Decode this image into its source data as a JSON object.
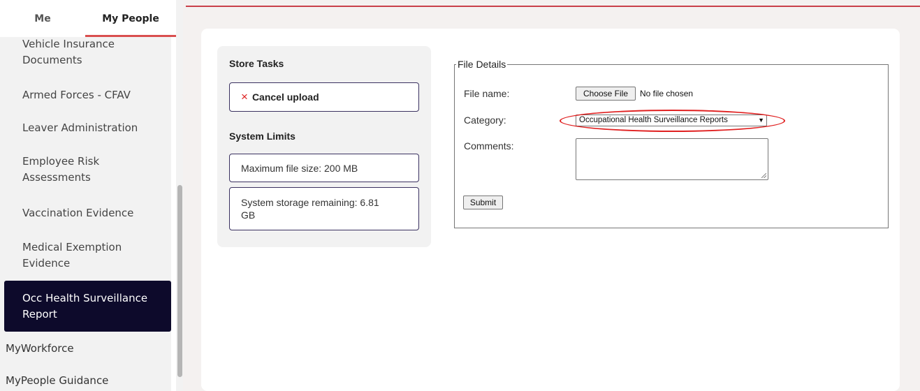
{
  "tabs": {
    "me": "Me",
    "my_people": "My People"
  },
  "sidebar": {
    "items": [
      {
        "line1": "Vehicle Insurance",
        "line2": "Documents"
      },
      {
        "line1": "Armed Forces - CFAV",
        "line2": ""
      },
      {
        "line1": "Leaver Administration",
        "line2": ""
      },
      {
        "line1": "Employee Risk",
        "line2": "Assessments"
      },
      {
        "line1": "Vaccination Evidence",
        "line2": ""
      },
      {
        "line1": "Medical Exemption",
        "line2": "Evidence"
      },
      {
        "line1": "Occ Health Surveillance",
        "line2": "Report",
        "active": true
      }
    ],
    "extra_links": [
      "MyWorkforce",
      "MyPeople Guidance"
    ]
  },
  "store_tasks": {
    "heading": "Store Tasks",
    "cancel_icon": "×",
    "cancel_label": "Cancel upload"
  },
  "system_limits": {
    "heading": "System Limits",
    "max_file_size": "Maximum file size: 200 MB",
    "storage_line1": "System storage remaining: 6.81",
    "storage_line2": "GB"
  },
  "file_details": {
    "legend": "File Details",
    "file_name_label": "File name:",
    "choose_file_button": "Choose File",
    "no_file_text": "No file chosen",
    "category_label": "Category:",
    "category_selected": "Occupational Health Surveillance Reports",
    "comments_label": "Comments:",
    "comments_value": "",
    "submit_button": "Submit"
  },
  "colors": {
    "active_nav_bg": "#0d0a2b",
    "accent_red": "#d94f4f",
    "highlight_red": "#e02020"
  }
}
